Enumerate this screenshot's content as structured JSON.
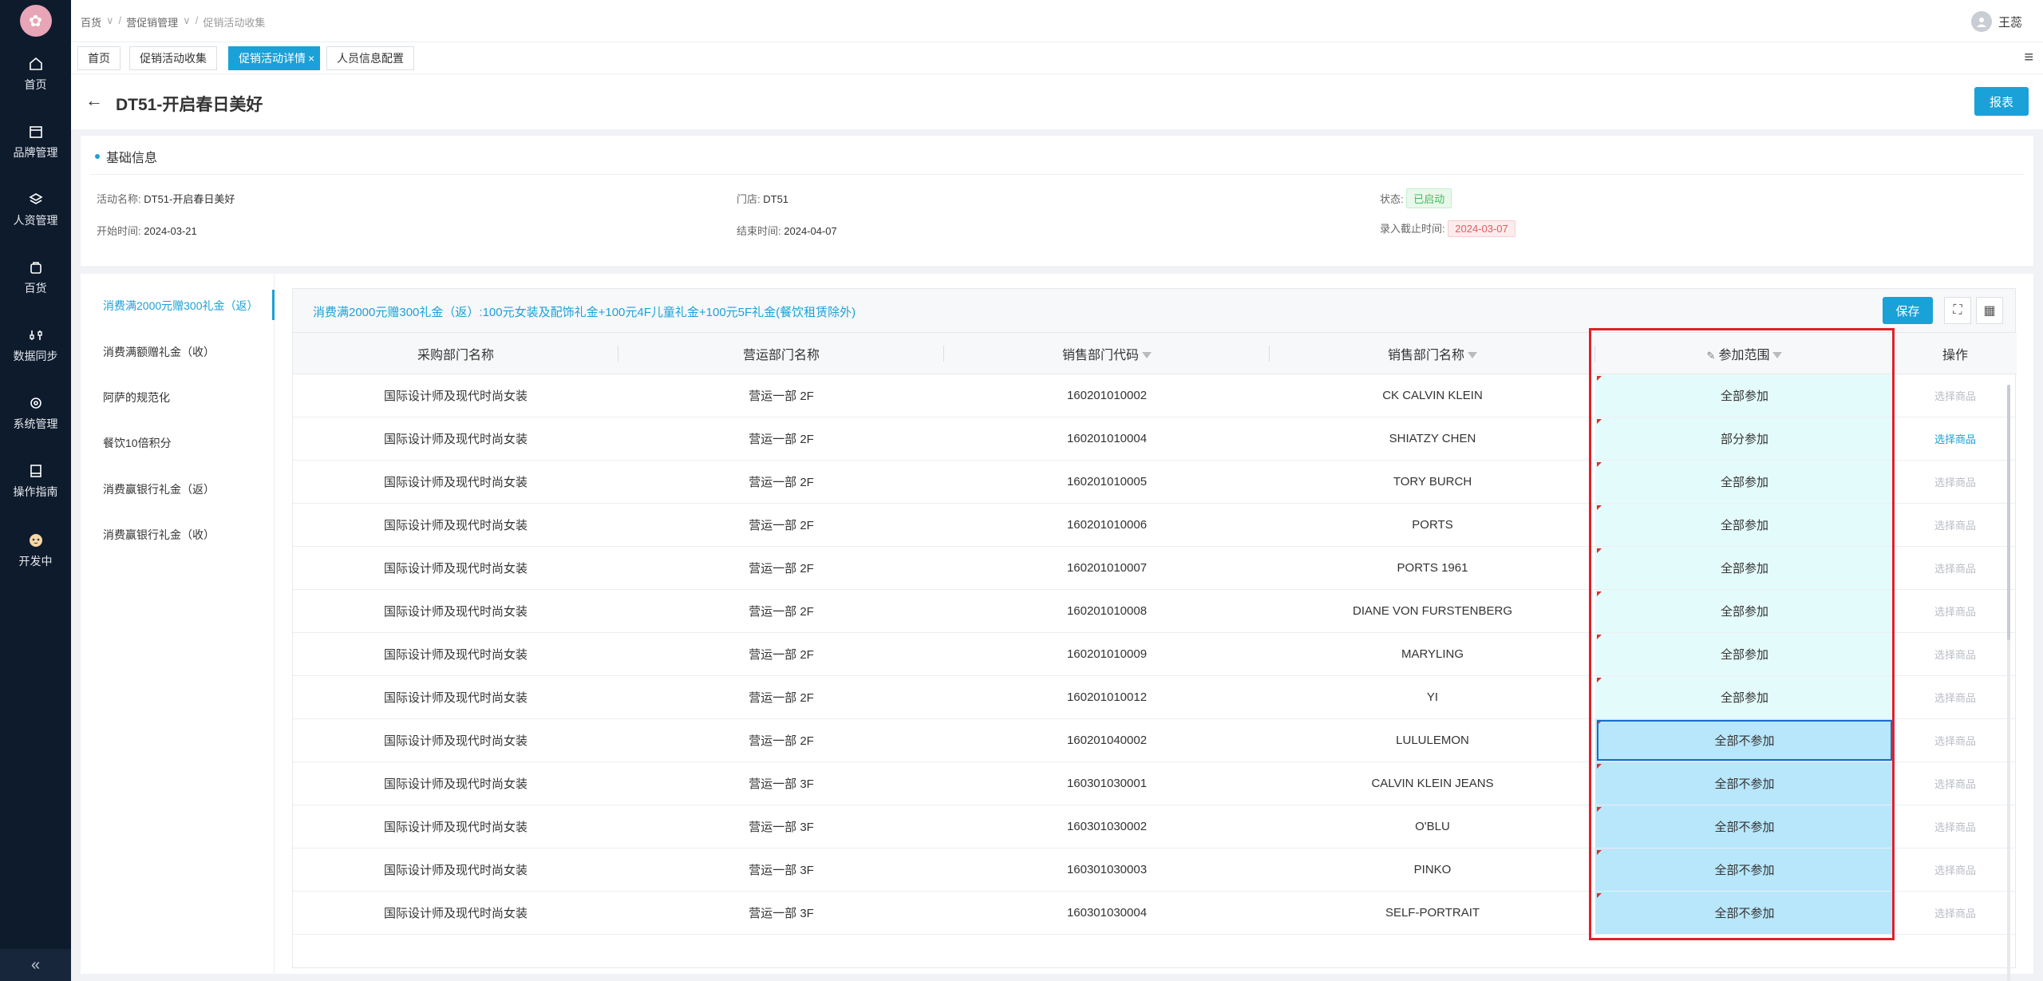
{
  "nav": {
    "logo_text": "✿",
    "items": [
      {
        "label": "首页",
        "icon": "home-icon"
      },
      {
        "label": "品牌管理",
        "icon": "brand-icon"
      },
      {
        "label": "人资管理",
        "icon": "layers-icon"
      },
      {
        "label": "百货",
        "icon": "bag-icon"
      },
      {
        "label": "数据同步",
        "icon": "sync-icon"
      },
      {
        "label": "系统管理",
        "icon": "gear-icon"
      },
      {
        "label": "操作指南",
        "icon": "book-icon"
      },
      {
        "label": "开发中",
        "icon": "cat-icon"
      }
    ],
    "collapse": "«"
  },
  "breadcrumb": [
    "百货",
    "营促销管理",
    "促销活动收集"
  ],
  "user": {
    "name": "王蕊"
  },
  "tabs": [
    {
      "label": "首页",
      "active": false
    },
    {
      "label": "促销活动收集",
      "active": false
    },
    {
      "label": "促销活动详情",
      "active": true,
      "close": "×"
    },
    {
      "label": "人员信息配置",
      "active": false
    }
  ],
  "page": {
    "title": "DT51-开启春日美好",
    "report_label": "报表",
    "back": "←"
  },
  "basic_info": {
    "header": "基础信息",
    "activity_name_key": "活动名称:",
    "activity_name": "DT51-开启春日美好",
    "store_key": "门店:",
    "store": "DT51",
    "status_key": "状态:",
    "status": "已启动",
    "start_key": "开始时间:",
    "start": "2024-03-21",
    "end_key": "结束时间:",
    "end": "2024-04-07",
    "cutoff_key": "录入截止时间:",
    "cutoff": "2024-03-07"
  },
  "promotions": [
    "消费满2000元赠300礼金（返）",
    "消费满额赠礼金（收）",
    "阿萨的规范化",
    "餐饮10倍积分",
    "消费赢银行礼金（返）",
    "消费赢银行礼金（收）"
  ],
  "panel": {
    "title": "消费满2000元赠300礼金（返）:100元女装及配饰礼金+100元4F儿童礼金+100元5F礼金(餐饮租赁除外)",
    "save_label": "保存",
    "fullscreen_icon": "⛶",
    "grid_icon": "▦"
  },
  "columns": [
    "采购部门名称",
    "营运部门名称",
    "销售部门代码",
    "销售部门名称",
    "参加范围",
    "操作"
  ],
  "rows": [
    {
      "purchase": "国际设计师及现代时尚女装",
      "ops": "营运一部 2F",
      "code": "160201010002",
      "name": "CK CALVIN KLEIN",
      "range": "全部参加",
      "op": "选择商品"
    },
    {
      "purchase": "国际设计师及现代时尚女装",
      "ops": "营运一部 2F",
      "code": "160201010004",
      "name": "SHIATZY CHEN",
      "range": "部分参加",
      "op": "选择商品"
    },
    {
      "purchase": "国际设计师及现代时尚女装",
      "ops": "营运一部 2F",
      "code": "160201010005",
      "name": "TORY BURCH",
      "range": "全部参加",
      "op": "选择商品"
    },
    {
      "purchase": "国际设计师及现代时尚女装",
      "ops": "营运一部 2F",
      "code": "160201010006",
      "name": "PORTS",
      "range": "全部参加",
      "op": "选择商品"
    },
    {
      "purchase": "国际设计师及现代时尚女装",
      "ops": "营运一部 2F",
      "code": "160201010007",
      "name": "PORTS 1961",
      "range": "全部参加",
      "op": "选择商品"
    },
    {
      "purchase": "国际设计师及现代时尚女装",
      "ops": "营运一部 2F",
      "code": "160201010008",
      "name": "DIANE VON FURSTENBERG",
      "range": "全部参加",
      "op": "选择商品"
    },
    {
      "purchase": "国际设计师及现代时尚女装",
      "ops": "营运一部 2F",
      "code": "160201010009",
      "name": "MARYLING",
      "range": "全部参加",
      "op": "选择商品"
    },
    {
      "purchase": "国际设计师及现代时尚女装",
      "ops": "营运一部 2F",
      "code": "160201010012",
      "name": "YI",
      "range": "全部参加",
      "op": "选择商品"
    },
    {
      "purchase": "国际设计师及现代时尚女装",
      "ops": "营运一部 2F",
      "code": "160201040002",
      "name": "LULULEMON",
      "range": "全部不参加",
      "op": "选择商品"
    },
    {
      "purchase": "国际设计师及现代时尚女装",
      "ops": "营运一部 3F",
      "code": "160301030001",
      "name": "CALVIN KLEIN JEANS",
      "range": "全部不参加",
      "op": "选择商品"
    },
    {
      "purchase": "国际设计师及现代时尚女装",
      "ops": "营运一部 3F",
      "code": "160301030002",
      "name": "O'BLU",
      "range": "全部不参加",
      "op": "选择商品"
    },
    {
      "purchase": "国际设计师及现代时尚女装",
      "ops": "营运一部 3F",
      "code": "160301030003",
      "name": "PINKO",
      "range": "全部不参加",
      "op": "选择商品"
    },
    {
      "purchase": "国际设计师及现代时尚女装",
      "ops": "营运一部 3F",
      "code": "160301030004",
      "name": "SELF-PORTRAIT",
      "range": "全部不参加",
      "op": "选择商品"
    }
  ]
}
